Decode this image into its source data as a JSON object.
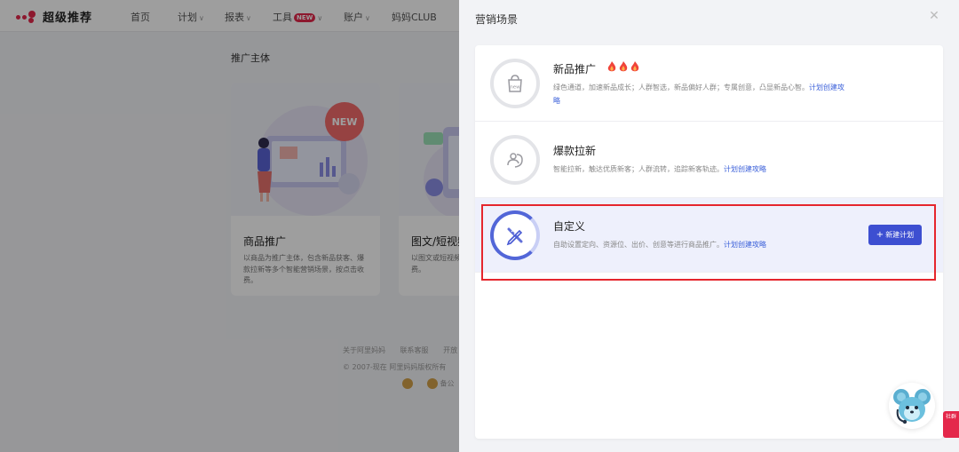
{
  "nav": {
    "brand": "超级推荐",
    "items": [
      {
        "label": "首页",
        "chevron": false
      },
      {
        "label": "计划",
        "chevron": true
      },
      {
        "label": "报表",
        "chevron": true
      },
      {
        "label": "工具",
        "chevron": true,
        "badge": "NEW"
      },
      {
        "label": "账户",
        "chevron": true
      },
      {
        "label": "妈妈CLUB",
        "chevron": false
      }
    ]
  },
  "background": {
    "section_title": "推广主体",
    "cards": [
      {
        "title": "商品推广",
        "desc": "以商品为推广主体，包含新品获客、爆款拉新等多个智能营销场景，按点击收费。",
        "badge": "NEW"
      },
      {
        "title": "图文/短视频",
        "desc": "以图文或短视频广，将内容推点击收费。"
      }
    ],
    "footer_links": [
      "关于阿里妈妈",
      "联系客服",
      "开放"
    ],
    "copyright": "© 2007-现在 阿里妈妈版权所有",
    "footer_badge": "备公"
  },
  "drawer": {
    "title": "营销场景",
    "close_icon": "close-icon",
    "scenes": [
      {
        "key": "new",
        "name": "新品推广",
        "icon": "new-product-bag-icon",
        "has_fire": true,
        "desc": "绿色通道，加速新品成长；人群智选，新品偏好人群；专属创意，凸显新品心智。",
        "link": "计划创建攻略"
      },
      {
        "key": "hot",
        "name": "爆款拉新",
        "icon": "people-swirl-icon",
        "has_fire": false,
        "desc": "智能拉新，触达优质新客；人群流转，追踪新客轨迹。",
        "link": "计划创建攻略"
      },
      {
        "key": "custom",
        "name": "自定义",
        "icon": "pencil-ruler-icon",
        "has_fire": false,
        "desc": "自助设置定向、资源位、出价、创意等进行商品推广。",
        "link": "计划创建攻略",
        "button": "新建计划"
      }
    ]
  },
  "side_tab": "社群",
  "colors": {
    "accent": "#3d4fd1",
    "brand": "#e4284b",
    "highlight": "#e5262d",
    "link": "#3a5fd9"
  }
}
